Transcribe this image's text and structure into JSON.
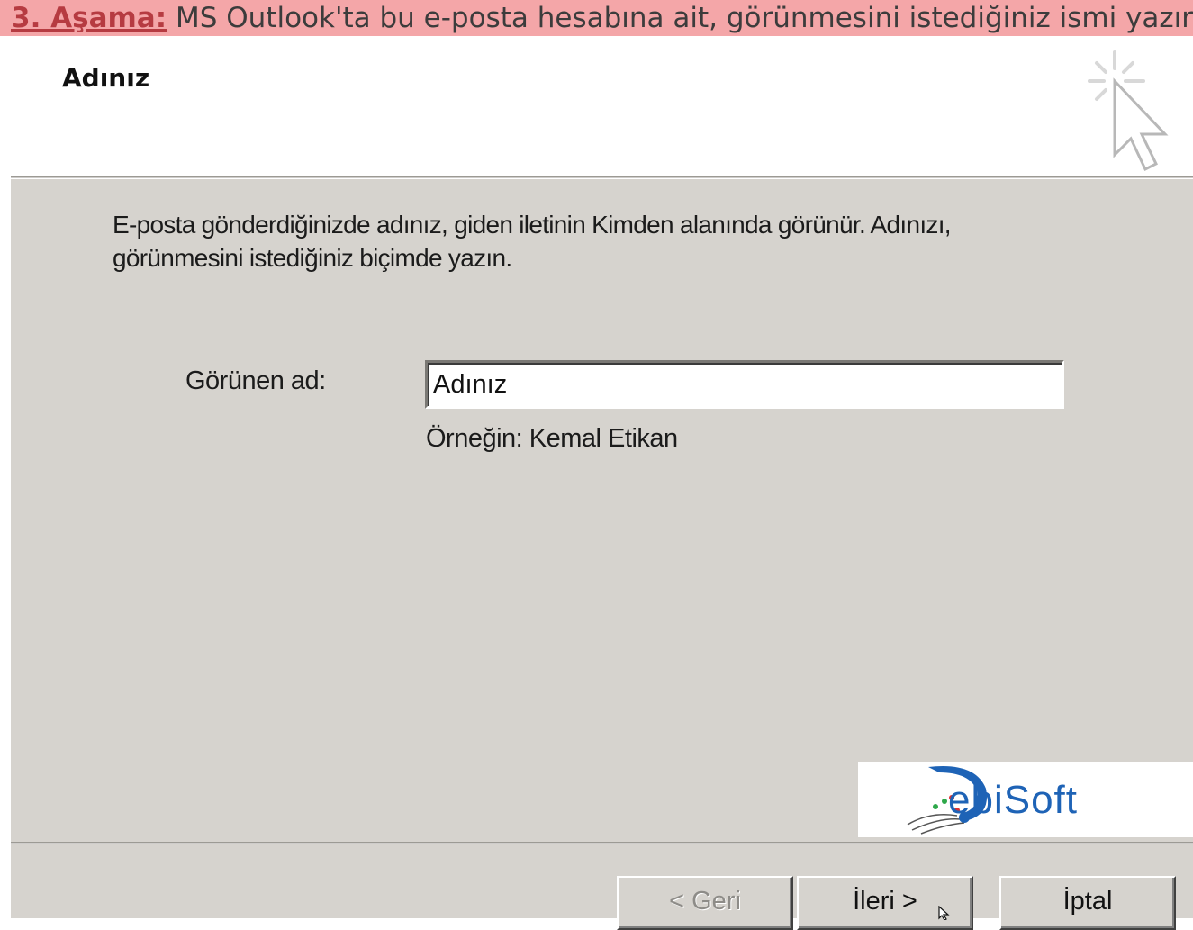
{
  "banner": {
    "step_label": "3. Aşama:",
    "text": " MS Outlook'ta bu e-posta hesabına ait, görünmesini istediğiniz ismi yazın"
  },
  "header": {
    "title": "Adınız"
  },
  "description": "E-posta gönderdiğinizde adınız, giden iletinin Kimden alanında görünür. Adınızı, görünmesini istediğiniz biçimde yazın.",
  "form": {
    "display_name_label": "Görünen ad:",
    "display_name_value": "Adınız",
    "example": "Örneğin: Kemal Etikan"
  },
  "logo": {
    "text": "ebiSoft"
  },
  "buttons": {
    "back": "< Geri",
    "next": "İleri >",
    "cancel": "İptal"
  },
  "colors": {
    "banner_bg": "#f4a6a8",
    "step_label": "#b63b41",
    "dialog_bg": "#d6d3ce",
    "logo_blue": "#1e63b6"
  }
}
